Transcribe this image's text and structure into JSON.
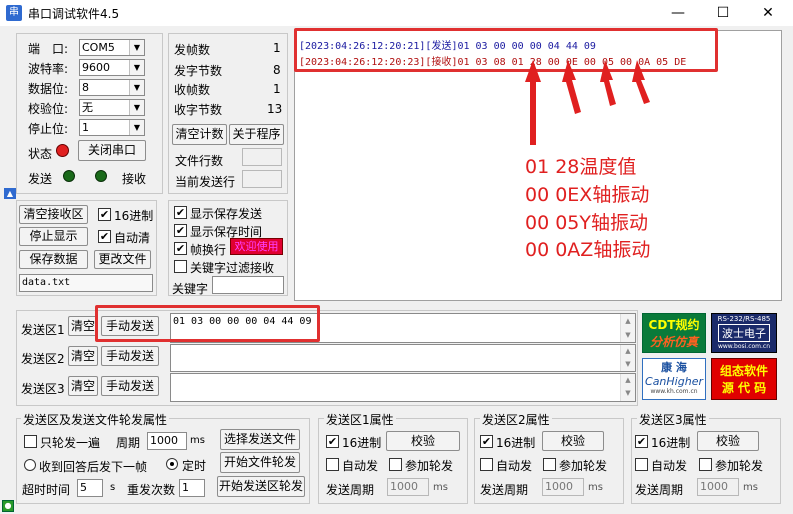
{
  "app": {
    "title": "串口调试软件4.5",
    "icon": "serial-app-icon"
  },
  "window_controls": {
    "minimize": "—",
    "maximize": "☐",
    "close": "✕"
  },
  "port": {
    "port_label": "端　口:",
    "port_value": "COM5",
    "baud_label": "波特率:",
    "baud_value": "9600",
    "data_label": "数据位:",
    "data_value": "8",
    "parity_label": "校验位:",
    "parity_value": "无",
    "stop_label": "停止位:",
    "stop_value": "1",
    "status_label": "状态",
    "close_button": "关闭串口",
    "send_label": "发送",
    "recv_label": "接收",
    "status_color": "#e02020",
    "led_color": "#1a6a1a"
  },
  "stats": {
    "tx_frames_label": "发帧数",
    "tx_frames": "1",
    "tx_bytes_label": "发字节数",
    "tx_bytes": "8",
    "rx_frames_label": "收帧数",
    "rx_frames": "1",
    "rx_bytes_label": "收字节数",
    "rx_bytes": "13",
    "clear_count": "清空计数",
    "about": "关于程序",
    "file_lines": "文件行数",
    "current_line": "当前发送行"
  },
  "recv_ctrl": {
    "clear_recv": "清空接收区",
    "hex_label": "16进制",
    "stop_display": "停止显示",
    "auto_clear": "自动清",
    "save_data": "保存数据",
    "change_file": "更改文件",
    "filename": "data.txt"
  },
  "display_opts": {
    "show_save_send": "显示保存发送",
    "show_save_time": "显示保存时间",
    "frame_newline": "帧换行",
    "badge": "欢迎使用",
    "keyword_filter": "关键字过滤接收",
    "keyword_label": "关键字"
  },
  "log": {
    "line1": "[2023:04:26:12:20:21][发送]01 03 00 00 00 04 44 09",
    "line2": "[2023:04:26:12:20:23][接收]01 03 08 01 28 00 0E 00 05 00 0A 05 DE",
    "line1_color": "#1a1aa0",
    "line2_color": "#b01010"
  },
  "annotations": [
    "01 28温度值",
    "00 0EX轴振动",
    "00 05Y轴振动",
    "00 0AZ轴振动"
  ],
  "send_areas": [
    {
      "label": "发送区1",
      "clear": "清空",
      "send": "手动发送",
      "content": "01 03 00 00 00 04 44 09"
    },
    {
      "label": "发送区2",
      "clear": "清空",
      "send": "手动发送",
      "content": ""
    },
    {
      "label": "发送区3",
      "clear": "清空",
      "send": "手动发送",
      "content": ""
    }
  ],
  "logos": {
    "cdt_top": "CDT规约",
    "cdt_bottom": "分析仿真",
    "bosi_top": "RS-232/RS-485",
    "bosi_mid": "波士电子",
    "bosi_url": "www.bosi.com.cn",
    "kanghai_top": "康 海",
    "kanghai_mid": "CanHigher",
    "kanghai_url": "www.kh.com.cn",
    "zutai_top": "组态软件",
    "zutai_bottom": "源 代 码"
  },
  "loop_props": {
    "title": "发送区及发送文件轮发属性",
    "only_once": "只轮发一遍",
    "period_label": "周期",
    "period_value": "1000",
    "ms": "ms",
    "select_file": "选择发送文件",
    "after_reply": "收到回答后发下一帧",
    "timed": "定时",
    "start_file": "开始文件轮发",
    "timeout_label": "超时时间",
    "timeout_value": "5",
    "s": "s",
    "retry_label": "重发次数",
    "retry_value": "1",
    "start_area": "开始发送区轮发"
  },
  "area_props": [
    {
      "title": "发送区1属性",
      "hex": "16进制",
      "checksum": "校验",
      "auto": "自动发",
      "join": "参加轮发",
      "period_label": "发送周期",
      "period_value": "1000",
      "ms": "ms"
    },
    {
      "title": "发送区2属性",
      "hex": "16进制",
      "checksum": "校验",
      "auto": "自动发",
      "join": "参加轮发",
      "period_label": "发送周期",
      "period_value": "1000",
      "ms": "ms"
    },
    {
      "title": "发送区3属性",
      "hex": "16进制",
      "checksum": "校验",
      "auto": "自动发",
      "join": "参加轮发",
      "period_label": "发送周期",
      "period_value": "1000",
      "ms": "ms"
    }
  ]
}
